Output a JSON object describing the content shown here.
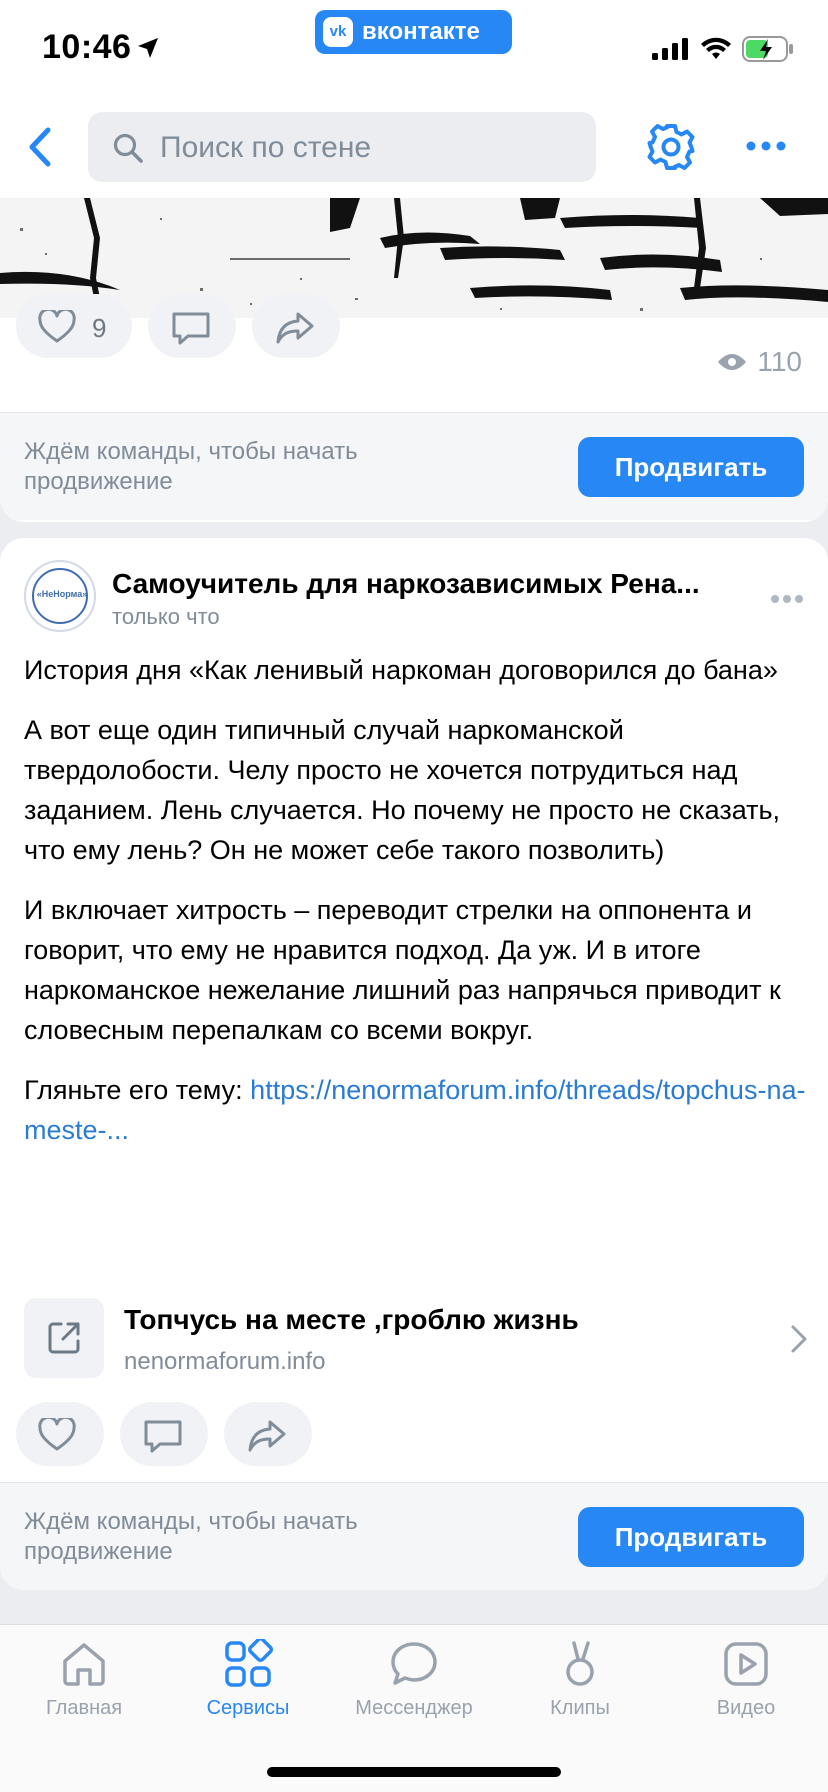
{
  "status_bar": {
    "time": "10:46",
    "app_badge": "вконтакте"
  },
  "header": {
    "search_placeholder": "Поиск по стене"
  },
  "post1": {
    "likes": "9",
    "views": "110",
    "promo_text": "Ждём команды, чтобы начать продвижение",
    "promo_button": "Продвигать"
  },
  "post2": {
    "author": "Самоучитель для наркозависимых Рена...",
    "time": "только что",
    "avatar_text": "«НеНорма»",
    "paragraphs": [
      "История дня «Как ленивый наркоман договорился до бана»",
      "А вот еще один типичный случай наркоманской твердолобости. Челу просто не хочется потрудиться над заданием. Лень случается. Но почему не просто не сказать, что ему лень? Он не может себе такого позволить)",
      "И включает хитрость – переводит стрелки на оппонента и говорит, что ему не нравится подход. Да уж. И в итоге наркоманское нежелание лишний раз напрячься приводит к словесным перепалкам со всеми вокруг."
    ],
    "link_prefix": "Гляньте его тему: ",
    "link_text": "https://nenormaforum.info/threads/topchus-na-meste-...",
    "snippet_title": "Топчусь на месте ,гроблю жизнь",
    "snippet_domain": "nenormaforum.info",
    "promo_text": "Ждём команды, чтобы начать продвижение",
    "promo_button": "Продвигать"
  },
  "tabbar": {
    "items": [
      {
        "label": "Главная",
        "icon": "home-icon"
      },
      {
        "label": "Сервисы",
        "icon": "services-icon",
        "active": true
      },
      {
        "label": "Мессенджер",
        "icon": "messenger-icon"
      },
      {
        "label": "Клипы",
        "icon": "clips-icon"
      },
      {
        "label": "Видео",
        "icon": "video-icon"
      }
    ]
  },
  "colors": {
    "accent": "#2787f5",
    "link": "#2a7bd4",
    "secondary_text": "#818c99",
    "background": "#ebedf0"
  }
}
